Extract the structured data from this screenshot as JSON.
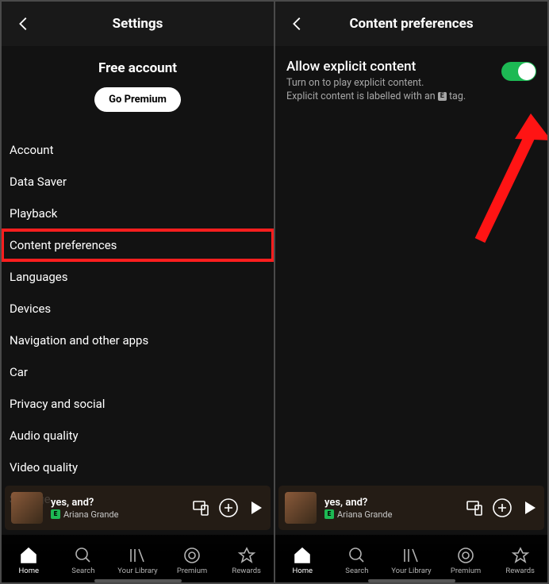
{
  "left": {
    "title": "Settings",
    "account_type": "Free account",
    "premium_btn": "Go Premium",
    "items": [
      "Account",
      "Data Saver",
      "Playback",
      "Content preferences",
      "Languages",
      "Devices",
      "Navigation and other apps",
      "Car",
      "Privacy and social",
      "Audio quality",
      "Video quality",
      "Storage"
    ],
    "highlight_index": 3
  },
  "right": {
    "title": "Content preferences",
    "toggle": {
      "heading": "Allow explicit content",
      "sub1": "Turn on to play explicit content.",
      "sub2a": "Explicit content is labelled with an",
      "sub2b": "tag.",
      "on": true
    }
  },
  "nowplaying": {
    "track": "yes, and?",
    "artist": "Ariana Grande",
    "explicit": true
  },
  "nav": {
    "items": [
      {
        "label": "Home",
        "icon": "home",
        "active": true
      },
      {
        "label": "Search",
        "icon": "search"
      },
      {
        "label": "Your Library",
        "icon": "library"
      },
      {
        "label": "Premium",
        "icon": "premium"
      },
      {
        "label": "Rewards",
        "icon": "rewards"
      }
    ]
  }
}
